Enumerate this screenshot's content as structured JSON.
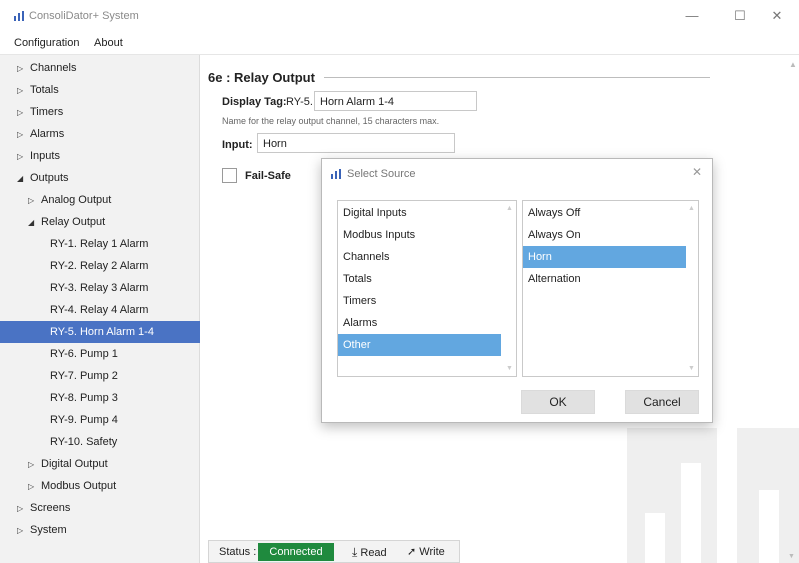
{
  "window": {
    "title": "ConsoliDator+ System",
    "logo_icon": "bar-chart-icon",
    "accent_color": "#4a73c4"
  },
  "menu": [
    "Configuration",
    "About"
  ],
  "sidebar": {
    "items": [
      {
        "label": "Channels",
        "expander": "collapsed"
      },
      {
        "label": "Totals",
        "expander": "collapsed"
      },
      {
        "label": "Timers",
        "expander": "collapsed"
      },
      {
        "label": "Alarms",
        "expander": "collapsed"
      },
      {
        "label": "Inputs",
        "expander": "collapsed"
      },
      {
        "label": "Outputs",
        "expander": "expanded"
      },
      {
        "label": "Analog Output",
        "expander": "collapsed"
      },
      {
        "label": "Relay Output",
        "expander": "expanded"
      },
      {
        "label": "RY-1. Relay 1 Alarm"
      },
      {
        "label": "RY-2. Relay 2 Alarm"
      },
      {
        "label": "RY-3. Relay 3 Alarm"
      },
      {
        "label": "RY-4. Relay 4 Alarm"
      },
      {
        "label": "RY-5. Horn Alarm 1-4",
        "selected": true
      },
      {
        "label": "RY-6. Pump 1"
      },
      {
        "label": "RY-7. Pump 2"
      },
      {
        "label": "RY-8. Pump 3"
      },
      {
        "label": "RY-9. Pump 4"
      },
      {
        "label": "RY-10. Safety"
      },
      {
        "label": "Digital Output",
        "expander": "collapsed"
      },
      {
        "label": "Modbus Output",
        "expander": "collapsed"
      },
      {
        "label": "Screens",
        "expander": "collapsed"
      },
      {
        "label": "System",
        "expander": "collapsed"
      }
    ]
  },
  "main": {
    "section_title": "6e : Relay Output",
    "display_tag": {
      "label": "Display Tag:",
      "prefix": "RY-5.",
      "value": "Horn Alarm 1-4"
    },
    "hint": "Name for the relay output channel, 15 characters max.",
    "input": {
      "label": "Input:",
      "value": "Horn"
    },
    "failsafe": {
      "label": "Fail-Safe",
      "checked": false
    }
  },
  "status": {
    "label": "Status :",
    "connection": "Connected",
    "connection_color": "#1f8a3e",
    "read_label": "Read",
    "write_label": "Write"
  },
  "dialog": {
    "title": "Select Source",
    "sources": [
      "Digital Inputs",
      "Modbus Inputs",
      "Channels",
      "Totals",
      "Timers",
      "Alarms",
      "Other"
    ],
    "selected_source": "Other",
    "options": [
      "Always Off",
      "Always On",
      "Horn",
      "Alternation"
    ],
    "selected_option": "Horn",
    "ok_label": "OK",
    "cancel_label": "Cancel",
    "selection_color": "#62a7e0"
  }
}
